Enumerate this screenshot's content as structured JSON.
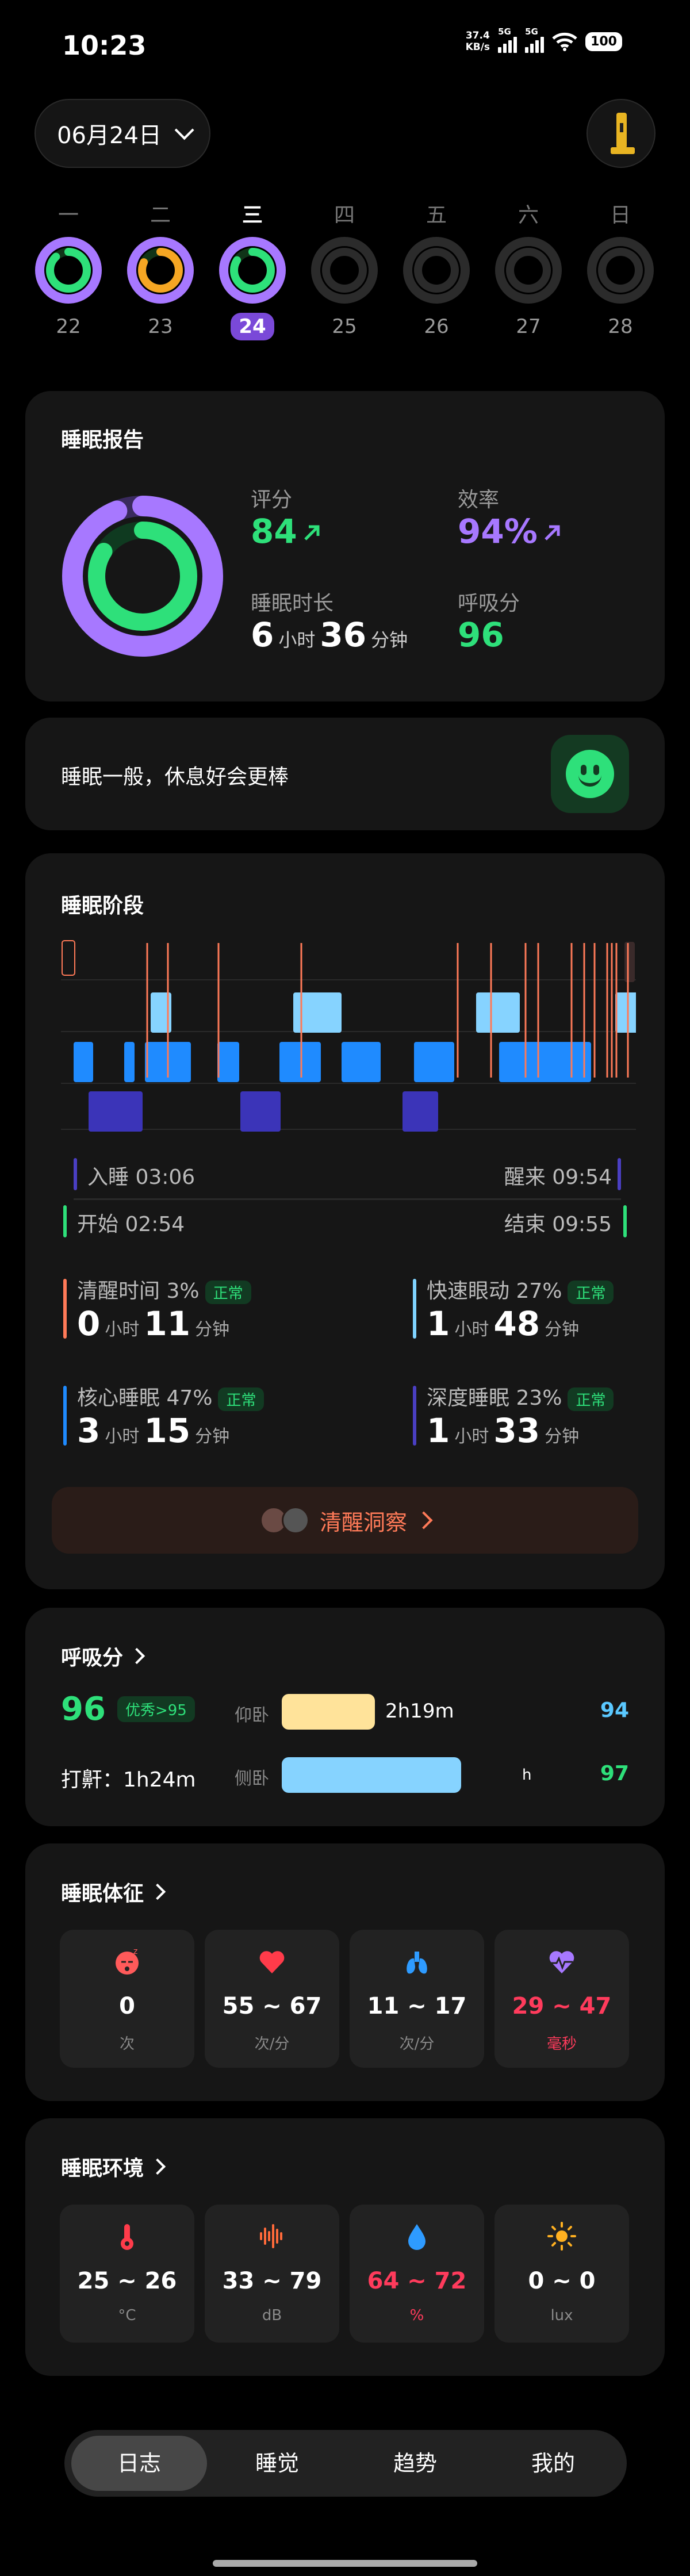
{
  "status_bar": {
    "time": "10:23",
    "net_speed": "37.4",
    "net_unit": "KB/s",
    "sim1": "5G",
    "sim2": "5G",
    "battery": "100"
  },
  "header": {
    "date": "06月24日"
  },
  "week": [
    {
      "weekday": "一",
      "date": "22",
      "outer_pct": 100,
      "inner_pct": 88,
      "inner_color": "#2ee07a",
      "active": false,
      "has_data": true
    },
    {
      "weekday": "二",
      "date": "23",
      "outer_pct": 100,
      "inner_pct": 82,
      "inner_color": "#f5a623",
      "active": false,
      "has_data": true
    },
    {
      "weekday": "三",
      "date": "24",
      "outer_pct": 100,
      "inner_pct": 84,
      "inner_color": "#2ee07a",
      "active": true,
      "has_data": true
    },
    {
      "weekday": "四",
      "date": "25",
      "has_data": false
    },
    {
      "weekday": "五",
      "date": "26",
      "has_data": false
    },
    {
      "weekday": "六",
      "date": "27",
      "has_data": false
    },
    {
      "weekday": "日",
      "date": "28",
      "has_data": false
    }
  ],
  "report": {
    "title": "睡眠报告",
    "score_label": "评分",
    "score": "84",
    "efficiency_label": "效率",
    "efficiency": "94%",
    "duration_label": "睡眠时长",
    "duration_h": "6",
    "duration_h_unit": "小时",
    "duration_m": "36",
    "duration_m_unit": "分钟",
    "breath_label": "呼吸分",
    "breath": "96",
    "ring_outer_pct": 94,
    "ring_inner_pct": 84
  },
  "summary": {
    "text": "睡眠一般，休息好会更棒"
  },
  "stages": {
    "title": "睡眠阶段",
    "fell_asleep_label": "入睡 03:06",
    "woke_label": "醒来 09:54",
    "start_label": "开始 02:54",
    "end_label": "结束 09:55",
    "awake": {
      "label": "清醒时间 3%",
      "badge": "正常",
      "h": "0",
      "m": "11",
      "color": "#ff7a58"
    },
    "rem": {
      "label": "快速眼动 27%",
      "badge": "正常",
      "h": "1",
      "m": "48",
      "color": "#7fd3ff"
    },
    "core": {
      "label": "核心睡眠 47%",
      "badge": "正常",
      "h": "3",
      "m": "15",
      "color": "#1f8bff"
    },
    "deep": {
      "label": "深度睡眠 23%",
      "badge": "正常",
      "h": "1",
      "m": "33",
      "color": "#4a3fc2"
    },
    "unit_h": "小时",
    "unit_m": "分钟",
    "insight": "清醒洞察"
  },
  "breathing": {
    "title": "呼吸分",
    "score": "96",
    "score_badge": "优秀>95",
    "snore_label": "打鼾：1h24m",
    "supine_label": "仰卧",
    "supine_time": "2h19m",
    "supine_score": "94",
    "side_label": "侧卧",
    "side_time": "h",
    "side_score": "97"
  },
  "vitals": {
    "title": "睡眠体征",
    "items": [
      {
        "value": "0",
        "unit": "次",
        "icon": "sleep-face-icon",
        "color": "#ff5a5a",
        "value_color": "#ffffff"
      },
      {
        "value": "55 ~ 67",
        "unit": "次/分",
        "icon": "heart-icon",
        "color": "#ff3b4a",
        "value_color": "#ffffff"
      },
      {
        "value": "11 ~ 17",
        "unit": "次/分",
        "icon": "lungs-icon",
        "color": "#2e9bff",
        "value_color": "#ffffff"
      },
      {
        "value": "29 ~ 47",
        "unit": "毫秒",
        "icon": "hrv-heart-icon",
        "color": "#a778ff",
        "value_color": "#ff3b5c"
      }
    ]
  },
  "environment": {
    "title": "睡眠环境",
    "items": [
      {
        "value": "25 ~ 26",
        "unit": "°C",
        "icon": "thermometer-icon",
        "color": "#ff3b4a",
        "value_color": "#ffffff"
      },
      {
        "value": "33 ~ 79",
        "unit": "dB",
        "icon": "sound-wave-icon",
        "color": "#ff6a3a",
        "value_color": "#ffffff"
      },
      {
        "value": "64 ~ 72",
        "unit": "%",
        "icon": "humidity-drop-icon",
        "color": "#2e9bff",
        "value_color": "#ff3b5c"
      },
      {
        "value": "0 ~ 0",
        "unit": "lux",
        "icon": "sun-icon",
        "color": "#ffb020",
        "value_color": "#ffffff"
      }
    ]
  },
  "nav": {
    "tabs": [
      "日志",
      "睡觉",
      "趋势",
      "我的"
    ],
    "active": 0
  }
}
